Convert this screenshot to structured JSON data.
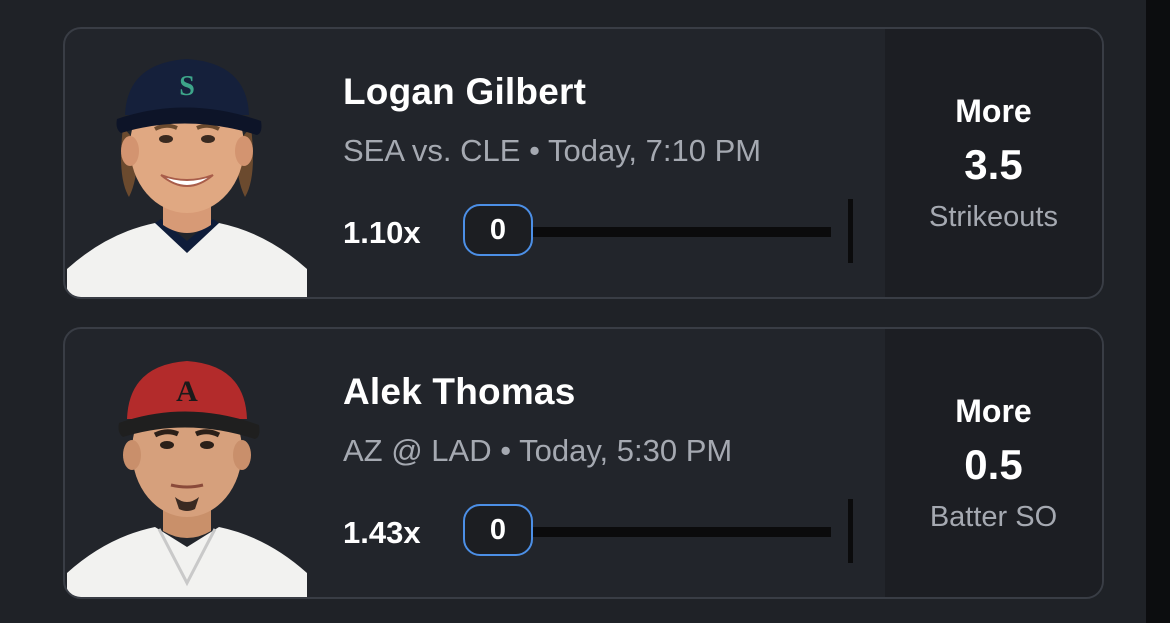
{
  "cards": [
    {
      "player": "Logan Gilbert",
      "matchup": "SEA vs. CLE • Today, 7:10 PM",
      "multiplier": "1.10x",
      "progress_value": "0",
      "direction": "More",
      "line": "3.5",
      "stat": "Strikeouts",
      "cap_color": "#15203b",
      "cap_logo": "S"
    },
    {
      "player": "Alek Thomas",
      "matchup": "AZ @ LAD • Today, 5:30 PM",
      "multiplier": "1.43x",
      "progress_value": "0",
      "direction": "More",
      "line": "0.5",
      "stat": "Batter SO",
      "cap_color": "#b32b2b",
      "cap_logo": "A"
    }
  ]
}
